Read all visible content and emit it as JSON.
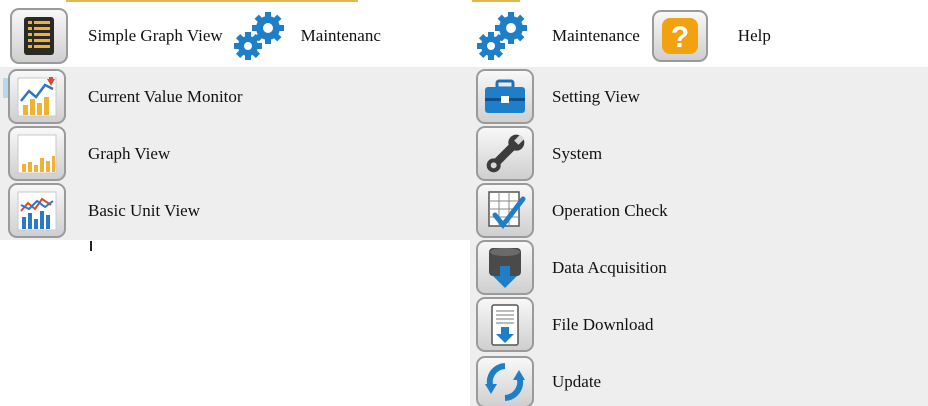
{
  "left_menu": {
    "items": [
      {
        "label": "Simple Graph View"
      },
      {
        "label": "Maintenanc"
      }
    ],
    "dropdown": [
      {
        "label": "Current Value Monitor"
      },
      {
        "label": "Graph View"
      },
      {
        "label": "Basic Unit View"
      }
    ]
  },
  "right_menu": {
    "items": [
      {
        "label": "Maintenance"
      },
      {
        "label": "Help"
      }
    ],
    "dropdown": [
      {
        "label": "Setting View"
      },
      {
        "label": "System"
      },
      {
        "label": "Operation Check"
      },
      {
        "label": "Data Acquisition"
      },
      {
        "label": "File Download"
      },
      {
        "label": "Update"
      }
    ]
  },
  "colors": {
    "accent": "#e2b94c",
    "dropdown_bg": "#eeeeee",
    "gear_blue": "#1e7fc8",
    "help_orange": "#f2a20f"
  }
}
